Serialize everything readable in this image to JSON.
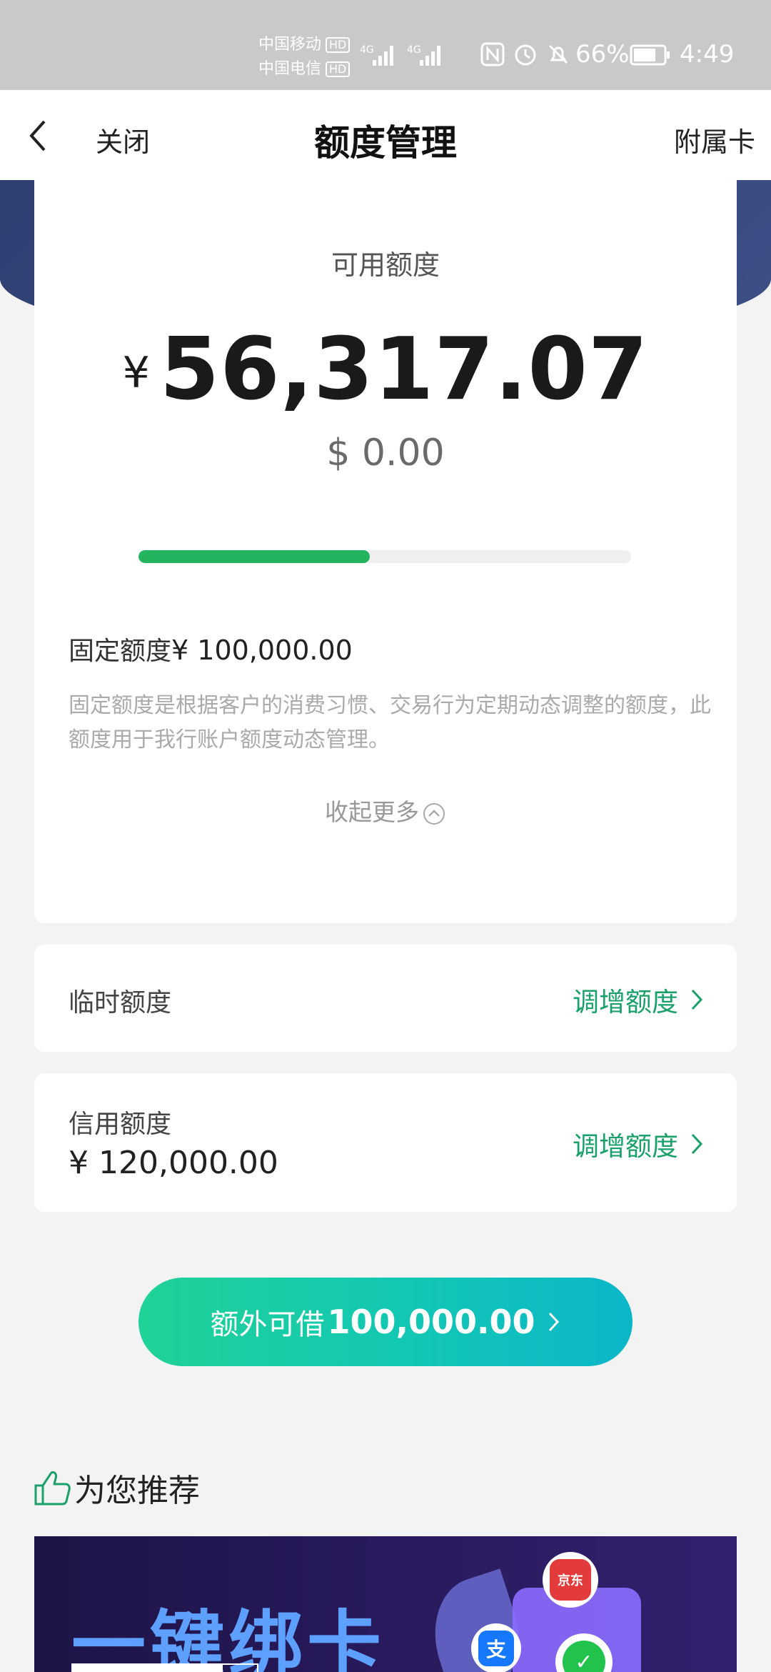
{
  "status_bar": {
    "carrier1": "中国移动",
    "carrier2": "中国电信",
    "hd_label": "HD",
    "net_label": "4G",
    "battery_pct": "66%",
    "time": "4:49"
  },
  "nav": {
    "close_label": "关闭",
    "title": "额度管理",
    "right_label": "附属卡"
  },
  "available": {
    "label": "可用额度",
    "currency_symbol": "¥",
    "amount": "56,317.07",
    "usd": "$ 0.00",
    "usage_fraction": 0.47
  },
  "fixed": {
    "label": "固定额度",
    "amount": "¥ 100,000.00",
    "description": "固定额度是根据客户的消费习惯、交易行为定期动态调整的额度，此额度用于我行账户额度动态管理。",
    "collapse_label": "收起更多"
  },
  "temporary": {
    "label": "临时额度",
    "action": "调增额度"
  },
  "credit": {
    "label": "信用额度",
    "amount": "¥ 120,000.00",
    "action": "调增额度"
  },
  "cta": {
    "label": "额外可借",
    "value": "100,000.00"
  },
  "recommend": {
    "title": "为您推荐"
  },
  "banner": {
    "title": "一键绑卡",
    "jd_label": "京东",
    "alipay_label": "支"
  },
  "colors": {
    "accent_green": "#1aa06b",
    "progress_green": "#24b35e",
    "nav_blue": "#3d4f86"
  }
}
